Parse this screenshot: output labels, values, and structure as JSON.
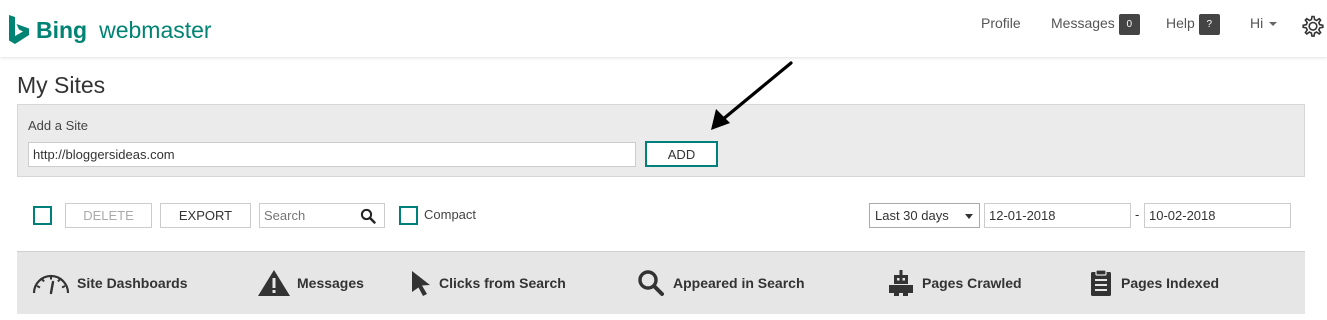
{
  "header": {
    "brand_bold": "Bing",
    "brand_light": "webmaster",
    "nav": {
      "profile": "Profile",
      "messages": "Messages",
      "messages_count": "0",
      "help": "Help",
      "help_badge": "?",
      "user": "Hi"
    },
    "icons": {
      "logo": "bing-logo-icon",
      "settings": "gear-icon",
      "user_menu": "chevron-down-icon"
    }
  },
  "page": {
    "title": "My Sites"
  },
  "add_site": {
    "label": "Add a Site",
    "value": "http://bloggersideas.com",
    "button": "ADD"
  },
  "toolbar": {
    "delete": "DELETE",
    "export": "EXPORT",
    "search_placeholder": "Search",
    "compact": "Compact",
    "range": "Last 30 days",
    "date_from": "12-01-2018",
    "date_sep": "-",
    "date_to": "10-02-2018"
  },
  "tabs": [
    {
      "label": "Site Dashboards",
      "icon": "dashboard-gauge-icon"
    },
    {
      "label": "Messages",
      "icon": "warning-icon"
    },
    {
      "label": "Clicks from Search",
      "icon": "cursor-icon"
    },
    {
      "label": "Appeared in Search",
      "icon": "search-icon"
    },
    {
      "label": "Pages Crawled",
      "icon": "robot-icon"
    },
    {
      "label": "Pages Indexed",
      "icon": "clipboard-icon"
    }
  ],
  "colors": {
    "accent": "#008373",
    "badge": "#444444",
    "panel": "#ebebeb",
    "tabs_bg": "#e6e6e6"
  }
}
